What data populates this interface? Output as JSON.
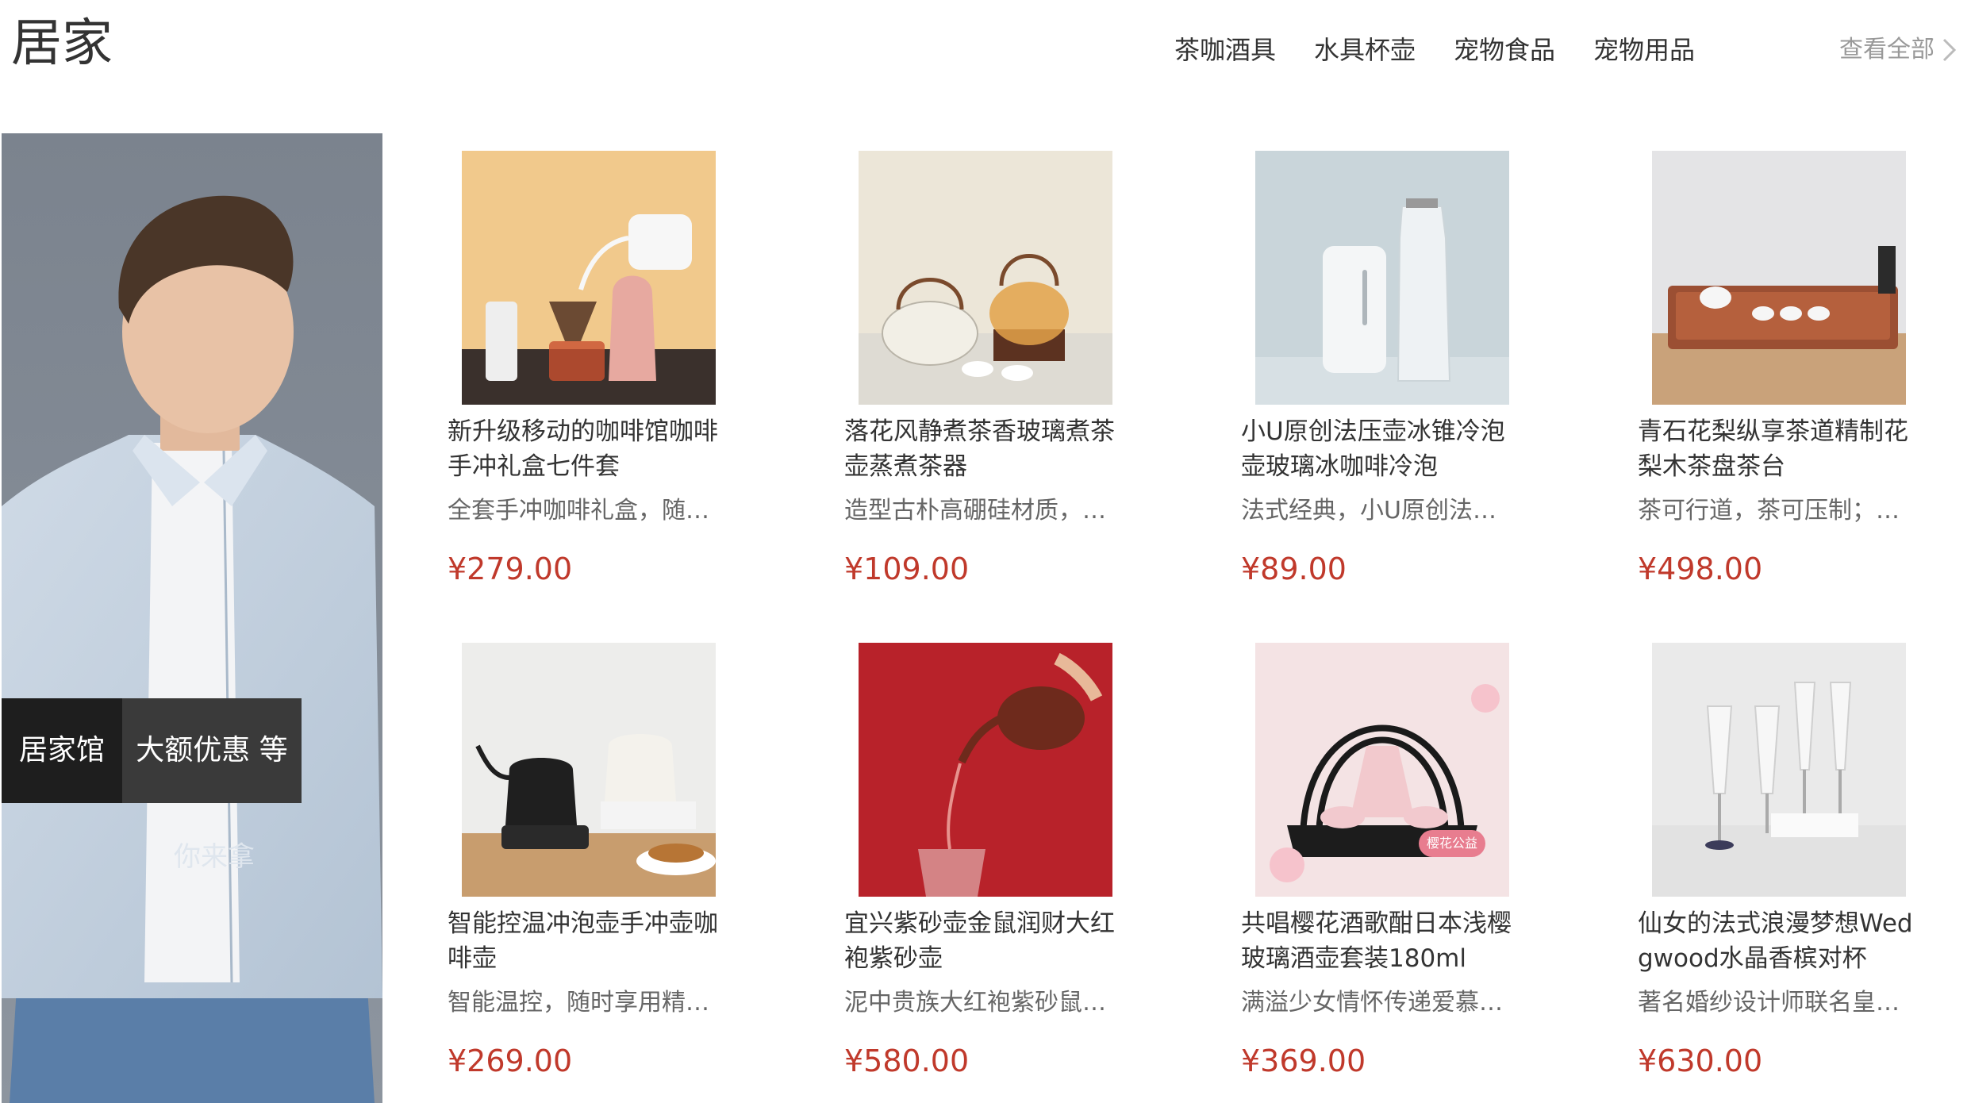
{
  "section": {
    "title": "居家",
    "tabs": [
      "茶咖酒具",
      "水具杯壶",
      "宠物食品",
      "宠物用品"
    ],
    "view_all": "查看全部"
  },
  "banner": {
    "tag_left": "居家馆",
    "tag_right": "大额优惠 等",
    "subtitle": "你来拿"
  },
  "colors": {
    "price": "#c0392b",
    "banner_bg": "#828a94",
    "tag_dark": "#1e1e1e",
    "tag_grey": "#3a3a3a"
  },
  "products": [
    {
      "name_1": "新升级移动的咖啡馆咖啡",
      "name_2": "手冲礼盒七件套",
      "desc": "全套手冲咖啡礼盒，随…",
      "price": "¥279.00"
    },
    {
      "name_1": "落花风静煮茶香玻璃煮茶",
      "name_2": "壶蒸煮茶器",
      "desc": "造型古朴高硼硅材质，…",
      "price": "¥109.00"
    },
    {
      "name_1": "小U原创法压壶冰锥冷泡",
      "name_2": "壶玻璃冰咖啡冷泡",
      "desc": "法式经典，小U原创法…",
      "price": "¥89.00"
    },
    {
      "name_1": "青石花梨纵享茶道精制花",
      "name_2": "梨木茶盘茶台",
      "desc": "茶可行道，茶可压制；…",
      "price": "¥498.00"
    },
    {
      "name_1": "智能控温冲泡壶手冲壶咖",
      "name_2": "啡壶",
      "desc": "智能温控，随时享用精…",
      "price": "¥269.00"
    },
    {
      "name_1": "宜兴紫砂壶金鼠润财大红",
      "name_2": "袍紫砂壶",
      "desc": "泥中贵族大红袍紫砂鼠…",
      "price": "¥580.00"
    },
    {
      "name_1": "共唱樱花酒歌酣日本浅樱",
      "name_2": "玻璃酒壶套装180ml",
      "desc": "满溢少女情怀传递爱慕…",
      "price": "¥369.00",
      "badge": "樱花公益"
    },
    {
      "name_1": "仙女的法式浪漫梦想Wed",
      "name_2": "gwood水晶香槟对杯",
      "desc": "著名婚纱设计师联名皇…",
      "price": "¥630.00"
    }
  ]
}
